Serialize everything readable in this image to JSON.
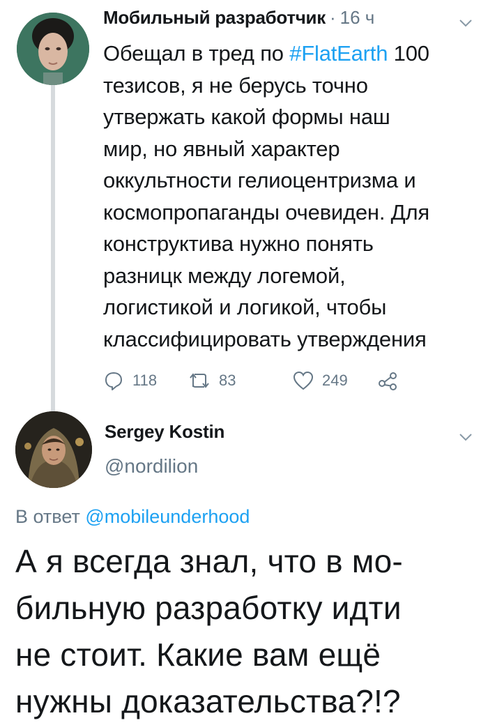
{
  "tweet1": {
    "author_name": "Мобильный разработчик",
    "separator": "·",
    "time": "16 ч",
    "text_before_hashtag": "Обещал в тред по ",
    "hashtag": "#FlatEarth",
    "text_after_hashtag": " 100\nтезисов, я не берусь точно\nутвержать какой формы наш\nмир, но явный характер\nоккультности гелиоцентризма и\nкосмопропаганды очевиден. Для\nконструктива нужно понять\nразницк между логемой,\nлогистикой и логикой, чтобы\nклассифицировать утверждения",
    "reply_count": "118",
    "retweet_count": "83",
    "like_count": "249"
  },
  "tweet2": {
    "author_name": "Sergey Kostin",
    "handle": "@nordilion",
    "reply_prefix": "В ответ ",
    "reply_mention": "@mobileunderhood",
    "text": "А я всегда знал, что в мо-\nбильную разработку идти\nне стоит. Какие вам ещё\nнужны доказательства?!?"
  },
  "colors": {
    "text": "#14171a",
    "secondary": "#657786",
    "link": "#1da1f2",
    "thread_line": "#d6dadd"
  },
  "icons": [
    "reply-icon",
    "retweet-icon",
    "like-icon",
    "share-icon",
    "chevron-down-icon"
  ]
}
